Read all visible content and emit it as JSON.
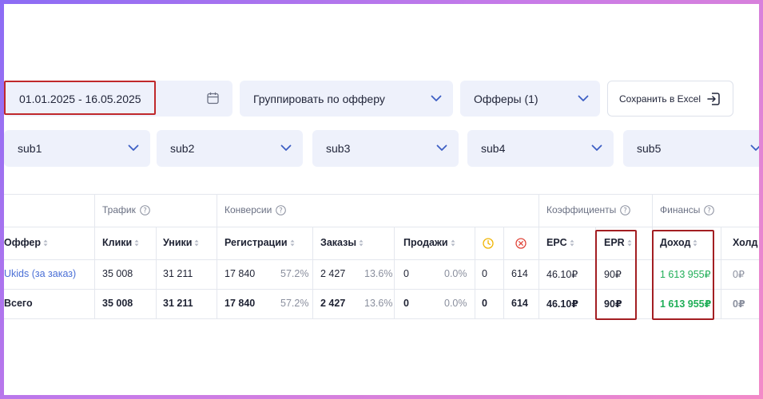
{
  "filters": {
    "date_range": "01.01.2025 - 16.05.2025",
    "group_by": "Группировать по офферу",
    "offers": "Офферы (1)",
    "export_label": "Сохранить в Excel",
    "subs": [
      "sub1",
      "sub2",
      "sub3",
      "sub4",
      "sub5"
    ]
  },
  "table": {
    "groups": {
      "traffic": "Трафик",
      "conversions": "Конверсии",
      "coefficients": "Коэффициенты",
      "finance": "Финансы"
    },
    "headers": {
      "offer": "Оффер",
      "clicks": "Клики",
      "uniques": "Уники",
      "registrations": "Регистрации",
      "orders": "Заказы",
      "sales": "Продажи",
      "epc": "EPC",
      "epr": "EPR",
      "income": "Доход",
      "hold": "Холд"
    },
    "rows": [
      {
        "offer": "Ukids (за заказ)",
        "clicks": "35 008",
        "uniques": "31 211",
        "registrations": "17 840",
        "reg_pct": "57.2%",
        "orders": "2 427",
        "orders_pct": "13.6%",
        "sales": "0",
        "sales_pct": "0.0%",
        "pending": "0",
        "rejected": "614",
        "epc": "46.10₽",
        "epr": "90₽",
        "income": "1 613 955₽",
        "hold": "0₽"
      },
      {
        "offer": "Всего",
        "clicks": "35 008",
        "uniques": "31 211",
        "registrations": "17 840",
        "reg_pct": "57.2%",
        "orders": "2 427",
        "orders_pct": "13.6%",
        "sales": "0",
        "sales_pct": "0.0%",
        "pending": "0",
        "rejected": "614",
        "epc": "46.10₽",
        "epr": "90₽",
        "income": "1 613 955₽",
        "hold": "0₽"
      }
    ]
  },
  "colors": {
    "accent_highlight": "#c0282b",
    "income_green": "#1fae57",
    "link_blue": "#4a6fd6",
    "pending_icon": "#f0b400",
    "rejected_icon": "#e0453a"
  }
}
